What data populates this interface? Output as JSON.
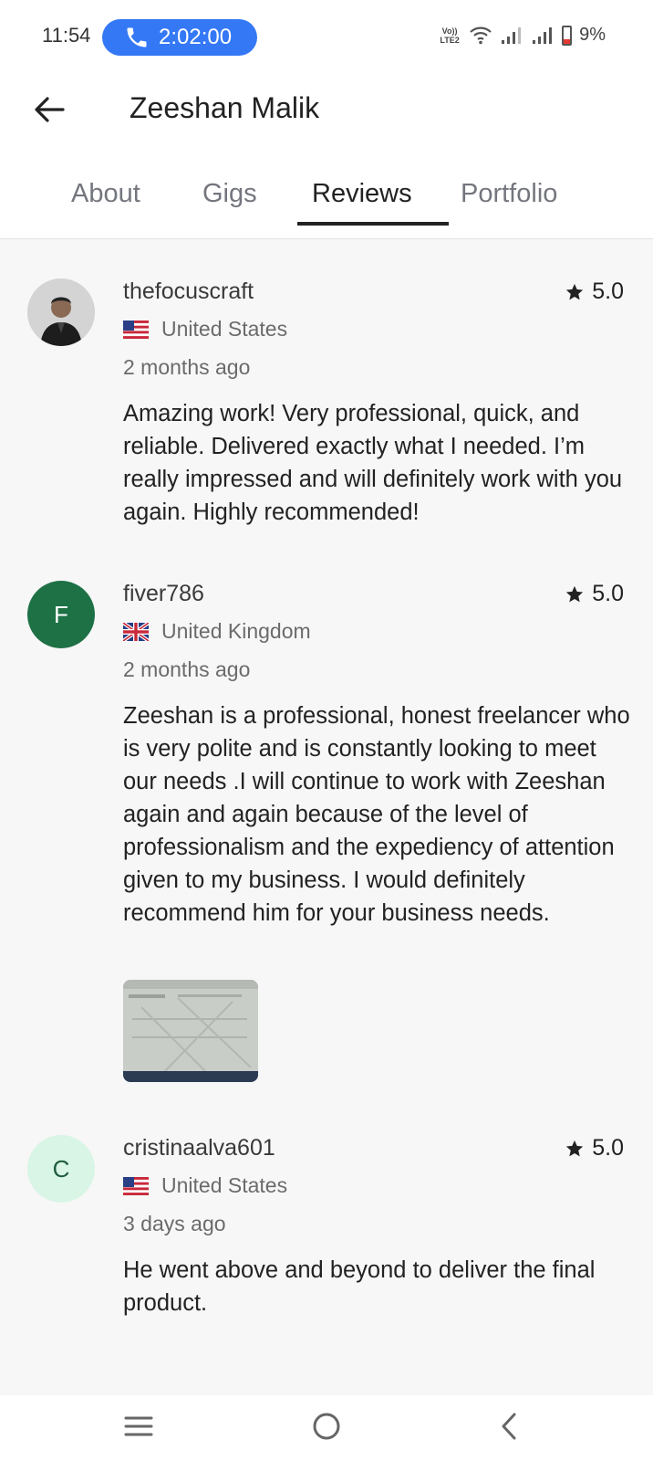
{
  "status_bar": {
    "time": "11:54",
    "call_timer": "2:02:00",
    "volte_line1": "Vo))",
    "volte_line2": "LTE2",
    "battery": "9%",
    "icons": [
      "phone-icon",
      "wifi-icon",
      "signal-icon",
      "signal-icon",
      "battery-icon"
    ],
    "colors": {
      "call_pill": "#3478f6",
      "battery_low": "#e53935"
    }
  },
  "header": {
    "title": "Zeeshan Malik",
    "back_icon": "arrow-left-icon"
  },
  "tabs": [
    {
      "label": "About",
      "active": false
    },
    {
      "label": "Gigs",
      "active": false
    },
    {
      "label": "Reviews",
      "active": true
    },
    {
      "label": "Portfolio",
      "active": false
    }
  ],
  "reviews": [
    {
      "username": "thefocuscraft",
      "avatar_type": "photo",
      "rating": "5.0",
      "country": "United States",
      "flag": "us-flag-icon",
      "date": "2 months ago",
      "text": "Amazing work! Very professional, quick, and reliable. Delivered exactly what I needed. I’m really impressed and will definitely work with you again. Highly recommended!"
    },
    {
      "username": "fiver786",
      "avatar_type": "initial",
      "avatar_initial": "F",
      "avatar_color": "#1e7145",
      "rating": "5.0",
      "country": "United Kingdom",
      "flag": "uk-flag-icon",
      "date": "2 months ago",
      "text": "Zeeshan is a professional, honest freelancer who is very polite and is constantly looking to meet our needs .I will continue to work with Zeeshan again and again because of the level of professionalism and the expediency of attention given to my business. I would definitely recommend him for your business needs.",
      "has_attachment": true
    },
    {
      "username": "cristinaalva601",
      "avatar_type": "initial",
      "avatar_initial": "C",
      "avatar_color": "#d9f5e6",
      "rating": "5.0",
      "country": "United States",
      "flag": "us-flag-icon",
      "date": "3 days ago",
      "text": "He went above and beyond to deliver the final product."
    }
  ],
  "bottom_nav": {
    "icons": [
      "recent-apps-icon",
      "home-icon",
      "back-icon"
    ]
  }
}
